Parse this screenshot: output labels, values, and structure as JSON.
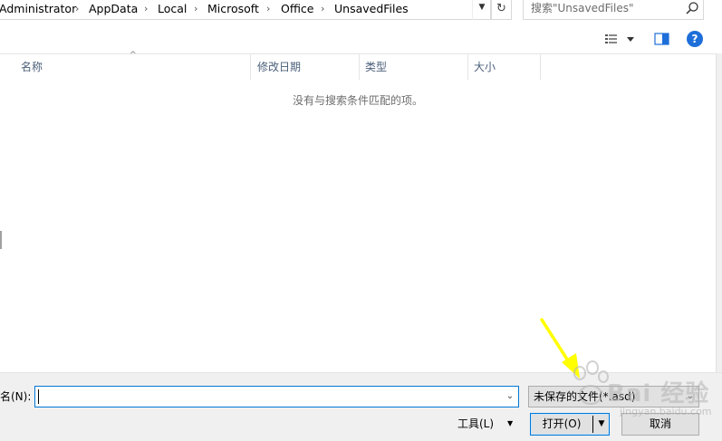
{
  "address_bar": {
    "crumbs": [
      "Administrator",
      "AppData",
      "Local",
      "Microsoft",
      "Office",
      "UnsavedFiles"
    ],
    "separator": "›"
  },
  "search": {
    "placeholder": "搜索\"UnsavedFiles\""
  },
  "toolbar": {
    "help_label": "?"
  },
  "file_list": {
    "columns": [
      "名称",
      "修改日期",
      "类型",
      "大小"
    ],
    "empty_message": "没有与搜索条件匹配的项。"
  },
  "bottom": {
    "filename_label": "名(N):",
    "filename_value": "",
    "filetype_value": "未保存的文件(*.asd)",
    "tools_label": "工具(L)",
    "open_label": "打开(O)",
    "cancel_label": "取消"
  },
  "watermark": {
    "text": "Bai 经验",
    "sub": "jingyan.baidu.com"
  },
  "colors": {
    "accent": "#0078d7",
    "help": "#1e6fd9",
    "panel": "#f0f0f0",
    "arrow": "#ffff00"
  }
}
